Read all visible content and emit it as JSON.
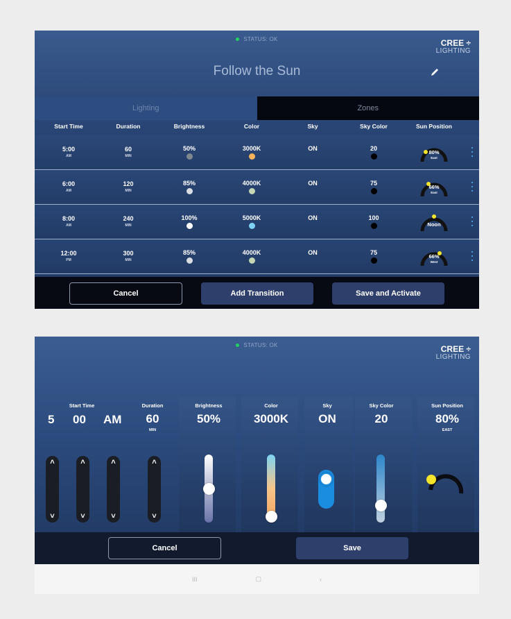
{
  "brand": {
    "line1": "CREE ÷",
    "line2": "LIGHTING"
  },
  "status": {
    "text": "STATUS: OK",
    "color": "#22d15f"
  },
  "screen1": {
    "title": "Follow the Sun",
    "tabs": [
      {
        "label": "Lighting",
        "active": true
      },
      {
        "label": "Zones",
        "active": false
      }
    ],
    "columns": [
      "Start Time",
      "Duration",
      "Brightness",
      "Color",
      "Sky",
      "Sky Color",
      "Sun Position"
    ],
    "rows": [
      {
        "time": "5:00",
        "ampm": "AM",
        "duration": "60",
        "dur_unit": "MIN",
        "brightness": "50%",
        "b_color": "#7d8790",
        "color": "3000K",
        "c_color": "#f8b35a",
        "sky": "ON",
        "sky_color": "20",
        "sun": "80%",
        "sun_label": "East"
      },
      {
        "time": "6:00",
        "ampm": "AM",
        "duration": "120",
        "dur_unit": "MIN",
        "brightness": "85%",
        "b_color": "#d8dde3",
        "color": "4000K",
        "c_color": "#c5d6b4",
        "sky": "ON",
        "sky_color": "75",
        "sun": "66%",
        "sun_label": "East"
      },
      {
        "time": "8:00",
        "ampm": "AM",
        "duration": "240",
        "dur_unit": "MIN",
        "brightness": "100%",
        "b_color": "#ffffff",
        "color": "5000K",
        "c_color": "#7fd4f5",
        "sky": "ON",
        "sky_color": "100",
        "sun": "Noon",
        "sun_label": ""
      },
      {
        "time": "12:00",
        "ampm": "PM",
        "duration": "300",
        "dur_unit": "MIN",
        "brightness": "85%",
        "b_color": "#d8dde3",
        "color": "4000K",
        "c_color": "#c5d6b4",
        "sky": "ON",
        "sky_color": "75",
        "sun": "66%",
        "sun_label": "West"
      }
    ],
    "buttons": {
      "cancel": "Cancel",
      "add": "Add Transition",
      "save": "Save and Activate"
    }
  },
  "screen2": {
    "start_time_label": "Start Time",
    "hour": "5",
    "minute": "00",
    "ampm": "AM",
    "duration": {
      "label": "Duration",
      "value": "60",
      "unit": "MIN"
    },
    "brightness": {
      "label": "Brightness",
      "value": "50%",
      "level": 0.5
    },
    "color": {
      "label": "Color",
      "value": "3000K",
      "level": 0.0
    },
    "sky": {
      "label": "Sky",
      "value": "ON"
    },
    "sky_color": {
      "label": "Sky Color",
      "value": "20",
      "level": 0.2
    },
    "sun_position": {
      "label": "Sun Position",
      "value": "80%",
      "sub": "EAST"
    },
    "buttons": {
      "cancel": "Cancel",
      "save": "Save"
    }
  },
  "icons": [
    "pencil-icon",
    "chevron-up-icon",
    "chevron-down-icon",
    "kebab-menu-icon",
    "sun-arc-icon",
    "nav-recent-icon",
    "nav-home-icon",
    "nav-back-icon"
  ],
  "navbar": {
    "recent": "III",
    "home": "▢",
    "back": "‹"
  }
}
